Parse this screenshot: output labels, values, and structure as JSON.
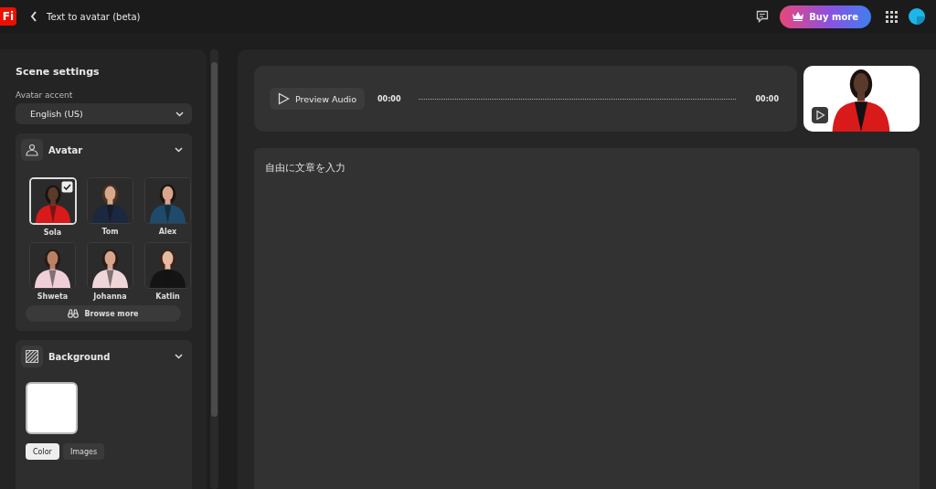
{
  "app": {
    "logo": "Fi",
    "title": "Text to avatar (beta)",
    "buy_button": "Buy more"
  },
  "sidebar": {
    "title": "Scene settings",
    "accent_label": "Avatar accent",
    "accent_value": "English (US)",
    "avatar_section": {
      "title": "Avatar",
      "expanded": true,
      "avatars": [
        {
          "name": "Sola",
          "selected": true
        },
        {
          "name": "Tom",
          "selected": false
        },
        {
          "name": "Alex",
          "selected": false
        },
        {
          "name": "Shweta",
          "selected": false
        },
        {
          "name": "Johanna",
          "selected": false
        },
        {
          "name": "Katlin",
          "selected": false
        }
      ],
      "browse_button": "Browse more"
    },
    "background_section": {
      "title": "Background",
      "expanded": true,
      "swatch": {
        "color": "#ffffff"
      },
      "tabs": [
        {
          "label": "Color",
          "selected": true
        },
        {
          "label": "Images",
          "selected": false
        }
      ]
    }
  },
  "audio": {
    "button": "Preview Audio",
    "start_time": "00:00",
    "end_time": "00:00"
  },
  "editor": {
    "placeholder": "自由に文章を入力"
  }
}
